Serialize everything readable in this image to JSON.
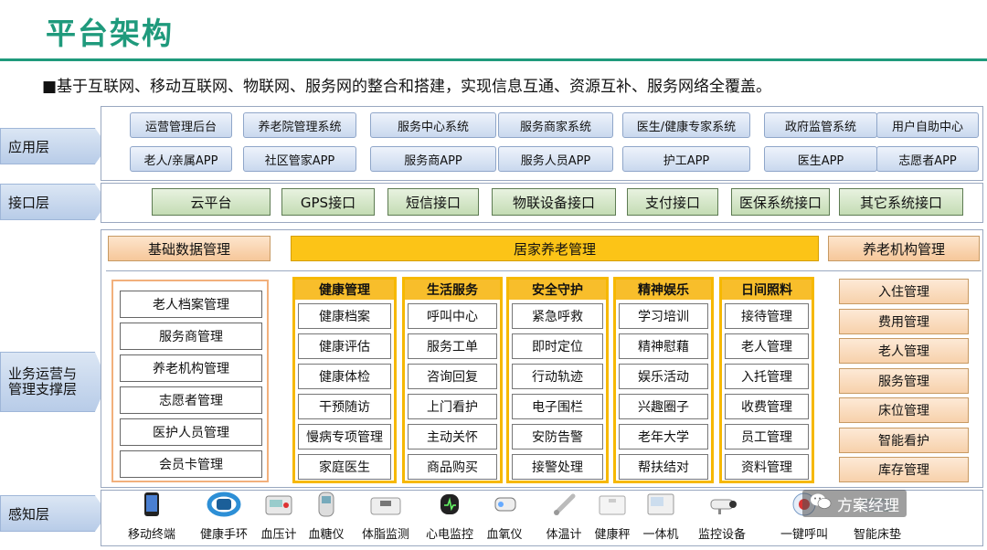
{
  "title": "平台架构",
  "subtitle": "■基于互联网、移动互联网、物联网、服务网的整合和搭建，实现信息互通、资源互补、服务网络全覆盖。",
  "layers": {
    "app": "应用层",
    "api": "接口层",
    "biz": "业务运营与管理支撑层",
    "sense": "感知层"
  },
  "app_row1": [
    "运营管理后台",
    "养老院管理系统",
    "服务中心系统",
    "服务商家系统",
    "医生/健康专家系统",
    "政府监管系统",
    "用户自助中心"
  ],
  "app_row2": [
    "老人/亲属APP",
    "社区管家APP",
    "服务商APP",
    "服务人员APP",
    "护工APP",
    "医生APP",
    "志愿者APP"
  ],
  "api_items": [
    "云平台",
    "GPS接口",
    "短信接口",
    "物联设备接口",
    "支付接口",
    "医保系统接口",
    "其它系统接口"
  ],
  "biz": {
    "left_header": "基础数据管理",
    "mid_header": "居家养老管理",
    "right_header": "养老机构管理",
    "left_items": [
      "老人档案管理",
      "服务商管理",
      "养老机构管理",
      "志愿者管理",
      "医护人员管理",
      "会员卡管理"
    ],
    "columns": [
      {
        "title": "健康管理",
        "items": [
          "健康档案",
          "健康评估",
          "健康体检",
          "干预随访",
          "慢病专项管理",
          "家庭医生"
        ]
      },
      {
        "title": "生活服务",
        "items": [
          "呼叫中心",
          "服务工单",
          "咨询回复",
          "上门看护",
          "主动关怀",
          "商品购买"
        ]
      },
      {
        "title": "安全守护",
        "items": [
          "紧急呼救",
          "即时定位",
          "行动轨迹",
          "电子围栏",
          "安防告警",
          "接警处理"
        ]
      },
      {
        "title": "精神娱乐",
        "items": [
          "学习培训",
          "精神慰藉",
          "娱乐活动",
          "兴趣圈子",
          "老年大学",
          "帮扶结对"
        ]
      },
      {
        "title": "日间照料",
        "items": [
          "接待管理",
          "老人管理",
          "入托管理",
          "收费管理",
          "员工管理",
          "资料管理"
        ]
      }
    ],
    "right_items": [
      "入住管理",
      "费用管理",
      "老人管理",
      "服务管理",
      "床位管理",
      "智能看护",
      "库存管理"
    ]
  },
  "devices": [
    {
      "label": "移动终端",
      "icon": "phone-icon"
    },
    {
      "label": "健康手环",
      "icon": "band-icon"
    },
    {
      "label": "血压计",
      "icon": "bp-meter-icon"
    },
    {
      "label": "血糖仪",
      "icon": "glucose-meter-icon"
    },
    {
      "label": "体脂监测",
      "icon": "body-fat-scale-icon"
    },
    {
      "label": "心电监控",
      "icon": "ecg-monitor-icon"
    },
    {
      "label": "血氧仪",
      "icon": "oximeter-icon"
    },
    {
      "label": "体温计",
      "icon": "thermometer-icon"
    },
    {
      "label": "健康秤",
      "icon": "scale-icon"
    },
    {
      "label": "一体机",
      "icon": "kiosk-icon"
    },
    {
      "label": "监控设备",
      "icon": "camera-icon"
    },
    {
      "label": "一键呼叫",
      "icon": "call-button-icon"
    },
    {
      "label": "智能床垫",
      "icon": "mattress-icon"
    }
  ],
  "watermark": "方案经理"
}
